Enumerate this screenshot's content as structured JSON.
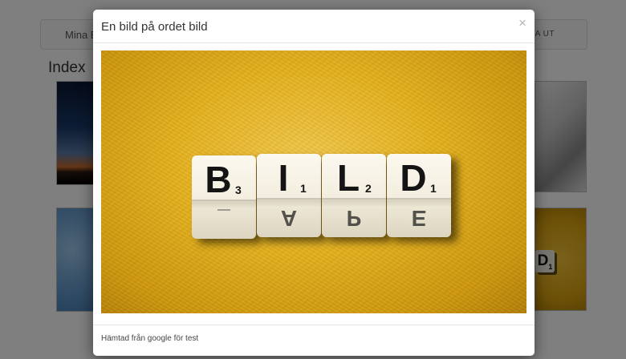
{
  "background": {
    "nav_brand": "Mina B",
    "nav_logout": "GA UT",
    "page_title": "Index",
    "thumbnail_die_letter": "D",
    "thumbnail_die_number": "1"
  },
  "modal": {
    "title": "En bild på ordet bild",
    "close_symbol": "×",
    "footer": "Hämtad från google för test"
  },
  "photo": {
    "description_icon": "scrabble-dice-photo",
    "dice": [
      {
        "letter": "B",
        "number": "3",
        "bottom": "_"
      },
      {
        "letter": "I",
        "number": "1",
        "bottom": "A"
      },
      {
        "letter": "L",
        "number": "2",
        "bottom": "P"
      },
      {
        "letter": "D",
        "number": "1",
        "bottom": "E"
      }
    ]
  },
  "colors": {
    "overlay": "#000000",
    "photo_background": "#e5b11c",
    "die_face": "#f3eedf"
  }
}
